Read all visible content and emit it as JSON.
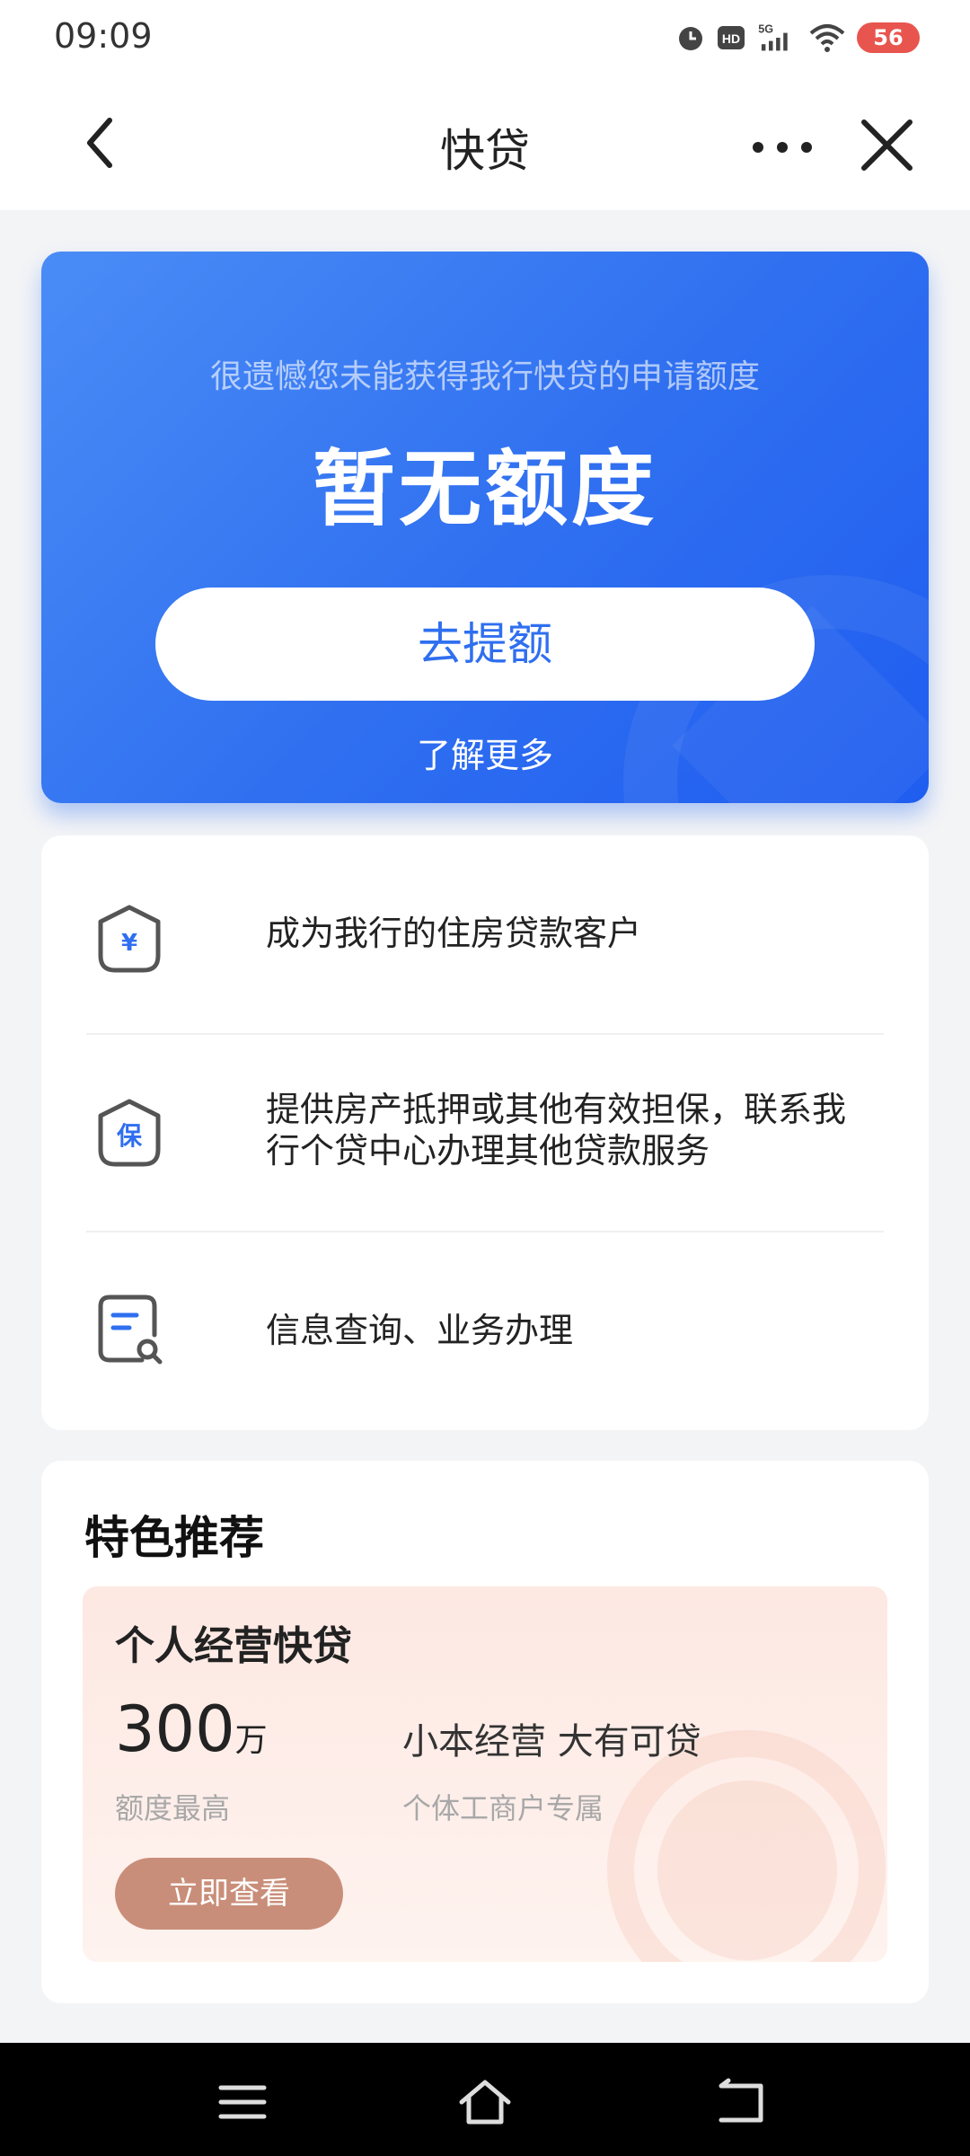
{
  "status_bar": {
    "time": "09:09",
    "battery": "56",
    "icons": [
      "alarm-icon",
      "hd-icon",
      "5g-signal-icon",
      "wifi-icon",
      "battery-icon"
    ]
  },
  "nav": {
    "title": "快贷",
    "back_icon": "chevron-left-icon",
    "more_icon": "more-dots-icon",
    "close_icon": "close-icon"
  },
  "hero": {
    "subtitle": "很遗憾您未能获得我行快贷的申请额度",
    "title": "暂无额度",
    "button_label": "去提额",
    "more_link": "了解更多",
    "colors": {
      "gradient_start": "#4a8cf6",
      "gradient_end": "#1f5df0",
      "button_text": "#2f6ff0"
    }
  },
  "options": [
    {
      "icon": "yuan-shield-icon",
      "text": "成为我行的住房贷款客户"
    },
    {
      "icon": "guarantee-shield-icon",
      "icon_char": "保",
      "text": "提供房产抵押或其他有效担保，联系我行个贷中心办理其他贷款服务"
    },
    {
      "icon": "document-search-icon",
      "text": "信息查询、业务办理"
    }
  ],
  "recommend": {
    "section_title": "特色推荐",
    "product": {
      "name": "个人经营快贷",
      "amount": "300",
      "amount_unit": "万",
      "amount_label": "额度最高",
      "slogan": "小本经营 大有可贷",
      "slogan_sub": "个体工商户专属",
      "button_label": "立即查看",
      "button_color": "#c98e79"
    }
  },
  "system_nav": {
    "icons": [
      "menu-icon",
      "home-icon",
      "back-icon"
    ]
  }
}
